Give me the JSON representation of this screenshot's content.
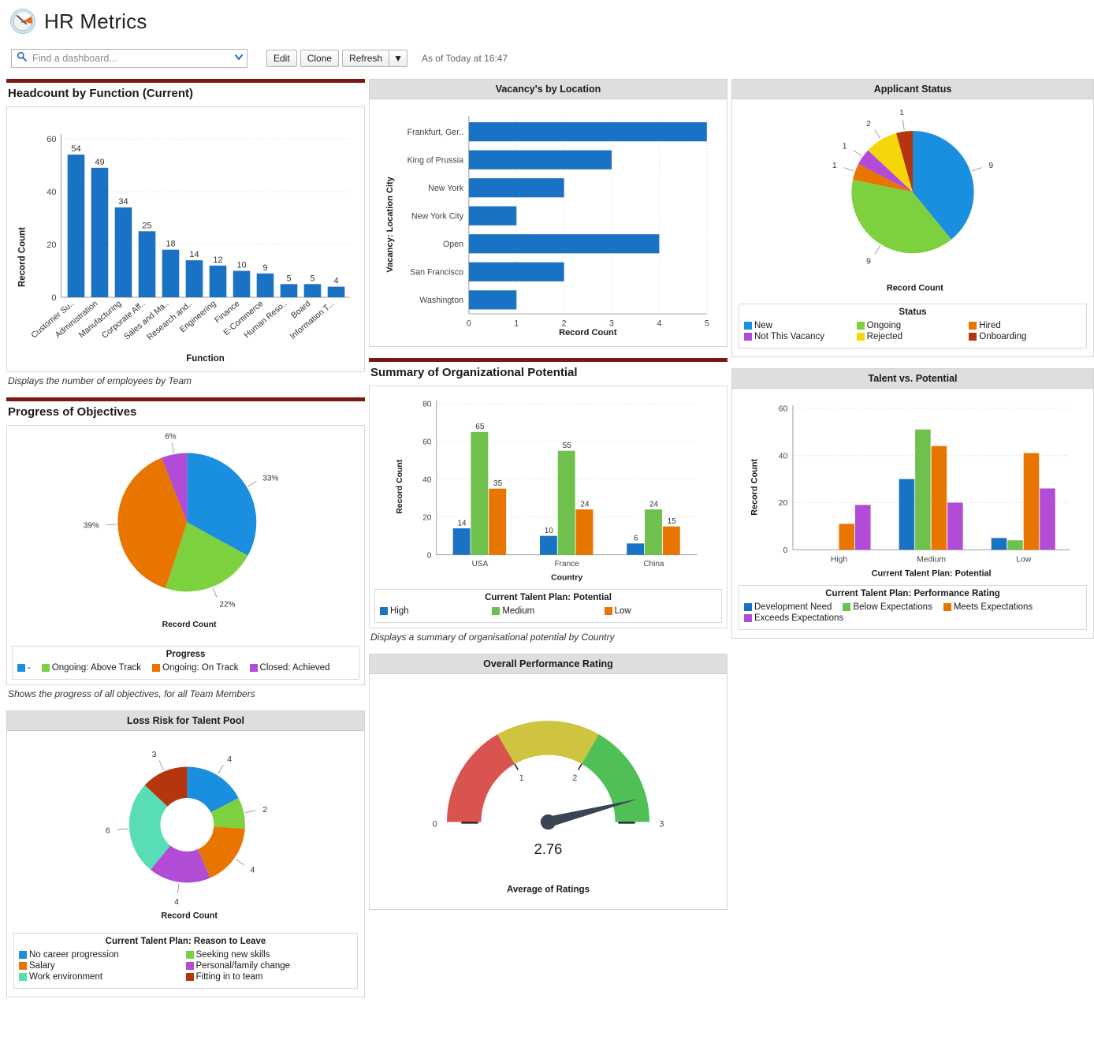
{
  "header": {
    "logo_icon": "dashboard-gauge-icon",
    "title": "HR Metrics",
    "search": {
      "placeholder": "Find a dashboard...",
      "value": "",
      "icon": "search-icon",
      "dropdown_icon": "chevron-down-icon"
    },
    "buttons": {
      "edit": "Edit",
      "clone": "Clone",
      "refresh": "Refresh",
      "refresh_caret": "▼"
    },
    "as_of": "As of Today at 16:47"
  },
  "components": {
    "headcount": {
      "title": "Headcount by Function (Current)",
      "footnote": "Displays the number of employees by Team"
    },
    "progress": {
      "title": "Progress of Objectives",
      "footnote": "Shows the progress of all objectives, for all Team Members"
    },
    "loss_risk": {
      "title": "Loss Risk for Talent Pool"
    },
    "vacancy": {
      "title": "Vacancy's by Location"
    },
    "org_potential": {
      "title": "Summary of Organizational Potential",
      "footnote": "Displays a summary of organisational potential by Country"
    },
    "performance": {
      "title": "Overall Performance Rating"
    },
    "applicant": {
      "title": "Applicant Status"
    },
    "talent": {
      "title": "Talent vs. Potential"
    }
  },
  "colors": {
    "blue": "#1a72c4",
    "green": "#6fc04c",
    "orange": "#e87500",
    "purple": "#b24bd6",
    "yellow": "#f5d60a",
    "dark_red": "#b5360c",
    "teal": "#59ddb6",
    "light_green": "#7dd13f",
    "accent_maroon": "#7b1a12",
    "panel_head": "#dedede",
    "gauge_red": "#d9534f",
    "gauge_yellow": "#cfc43f",
    "gauge_green": "#4fbf56"
  },
  "chart_data": [
    {
      "id": "headcount",
      "type": "bar",
      "title": "Headcount by Function (Current)",
      "xlabel": "Function",
      "ylabel": "Record Count",
      "ylim": [
        0,
        60
      ],
      "yticks": [
        0,
        20,
        40,
        60
      ],
      "grid": true,
      "legend": "none",
      "categories": [
        "Customer Su..",
        "Administration",
        "Manufacturing",
        "Corporate Aff..",
        "Sales and Ma..",
        "Research and..",
        "Engineering",
        "Finance",
        "E-Commerce",
        "Human Reso..",
        "Board",
        "Information T..."
      ],
      "values": [
        54,
        49,
        34,
        25,
        18,
        14,
        12,
        10,
        9,
        5,
        5,
        4
      ]
    },
    {
      "id": "vacancy",
      "type": "bar",
      "orientation": "horizontal",
      "title": "Vacancy's by Location",
      "xlabel": "Record Count",
      "ylabel": "Vacancy: Location City",
      "xlim": [
        0,
        5
      ],
      "xticks": [
        0,
        1,
        2,
        3,
        4,
        5
      ],
      "grid": true,
      "legend": "none",
      "categories": [
        "Frankfurt, Ger..",
        "King of Prussia",
        "New York",
        "New York City",
        "Open",
        "San Francisco",
        "Washington"
      ],
      "values": [
        5,
        3,
        2,
        1,
        4,
        2,
        1
      ]
    },
    {
      "id": "applicant_status",
      "type": "pie",
      "title": "Applicant Status",
      "value_label": "Record Count",
      "legend_title": "Status",
      "legend_position": "bottom",
      "labels": [
        "New",
        "Ongoing",
        "Hired",
        "Not This Vacancy",
        "Rejected",
        "Onboarding"
      ],
      "values": [
        9,
        9,
        1,
        1,
        2,
        1
      ],
      "slice_colors": [
        "#1a8fe0",
        "#7dd13f",
        "#e87500",
        "#b24bd6",
        "#f5d60a",
        "#b5360c"
      ]
    },
    {
      "id": "progress_objectives",
      "type": "pie",
      "title": "Progress of Objectives",
      "value_label": "Record Count",
      "legend_title": "Progress",
      "legend_position": "bottom",
      "labels": [
        "-",
        "Ongoing: Above Track",
        "Ongoing: On Track",
        "Closed: Achieved"
      ],
      "values": [
        33,
        22,
        39,
        6
      ],
      "value_labels": [
        "33%",
        "22%",
        "39%",
        "6%"
      ],
      "slice_colors": [
        "#1a8fe0",
        "#7dd13f",
        "#e87500",
        "#b24bd6"
      ]
    },
    {
      "id": "loss_risk",
      "type": "pie",
      "variant": "donut",
      "title": "Loss Risk for Talent Pool",
      "value_label": "Record Count",
      "legend_title": "Current Talent Plan: Reason to Leave",
      "legend_position": "bottom",
      "labels": [
        "No career progression",
        "Seeking new skills",
        "Salary",
        "Personal/family change",
        "Work environment",
        "Fitting in to team"
      ],
      "values": [
        4,
        2,
        4,
        4,
        6,
        3
      ],
      "slice_colors": [
        "#1a8fe0",
        "#7dd13f",
        "#e87500",
        "#b24bd6",
        "#59ddb6",
        "#b5360c"
      ]
    },
    {
      "id": "org_potential",
      "type": "bar",
      "title": "Summary of Organizational Potential",
      "xlabel": "Country",
      "ylabel": "Record Count",
      "ylim": [
        0,
        80
      ],
      "yticks": [
        0,
        20,
        40,
        60,
        80
      ],
      "grid": true,
      "legend_title": "Current Talent Plan: Potential",
      "legend_position": "bottom",
      "categories": [
        "USA",
        "France",
        "China"
      ],
      "series": [
        {
          "name": "High",
          "values": [
            14,
            10,
            6
          ],
          "color": "#1a72c4"
        },
        {
          "name": "Medium",
          "values": [
            65,
            55,
            24
          ],
          "color": "#6fc04c"
        },
        {
          "name": "Low",
          "values": [
            35,
            24,
            15
          ],
          "color": "#e87500"
        }
      ]
    },
    {
      "id": "talent_vs_potential",
      "type": "bar",
      "title": "Talent vs. Potential",
      "xlabel": "Current Talent Plan: Potential",
      "ylabel": "Record Count",
      "ylim": [
        0,
        60
      ],
      "yticks": [
        0,
        20,
        40,
        60
      ],
      "grid": true,
      "legend_title": "Current Talent Plan: Performance Rating",
      "legend_position": "bottom",
      "categories": [
        "High",
        "Medium",
        "Low"
      ],
      "series": [
        {
          "name": "Development Need",
          "values": [
            0,
            30,
            5
          ],
          "color": "#1a72c4"
        },
        {
          "name": "Below Expectations",
          "values": [
            0,
            51,
            4
          ],
          "color": "#6fc04c"
        },
        {
          "name": "Meets Expectations",
          "values": [
            11,
            44,
            41
          ],
          "color": "#e87500"
        },
        {
          "name": "Exceeds Expectations",
          "values": [
            19,
            20,
            26
          ],
          "color": "#b24bd6"
        }
      ]
    },
    {
      "id": "performance_gauge",
      "type": "gauge",
      "title": "Overall Performance Rating",
      "value": 2.76,
      "value_text": "2.76",
      "min": 0,
      "max": 3,
      "ticks": [
        0,
        1,
        2,
        3
      ],
      "caption": "Average of Ratings",
      "bands": [
        {
          "from": 0,
          "to": 1,
          "color": "#d9534f"
        },
        {
          "from": 1,
          "to": 2,
          "color": "#cfc43f"
        },
        {
          "from": 2,
          "to": 3,
          "color": "#4fbf56"
        }
      ]
    }
  ]
}
